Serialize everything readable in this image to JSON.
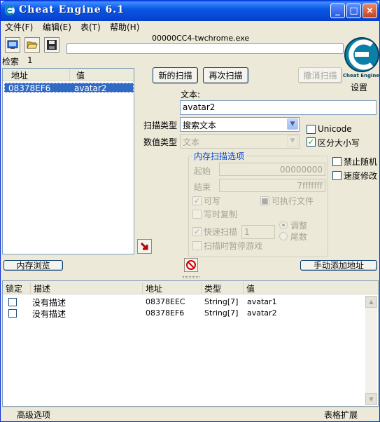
{
  "window": {
    "title": "Cheat Engine 6.1",
    "btn_minimize": "_",
    "btn_maximize": "□",
    "btn_close": "×"
  },
  "menu": [
    "文件(F)",
    "编辑(E)",
    "表(T)",
    "帮助(H)"
  ],
  "process": {
    "name": "00000CC4-twchrome.exe"
  },
  "found": {
    "label": "检索",
    "count": "1"
  },
  "results": {
    "col_address": "地址",
    "col_value": "值",
    "rows": [
      {
        "address": "08378EF6",
        "value": "avatar2"
      }
    ]
  },
  "scan": {
    "new_scan": "新的扫描",
    "next_scan": "再次扫描",
    "undo_scan": "撤消扫描",
    "settings": "设置",
    "text_label": "文本:",
    "text_value": "avatar2",
    "scan_type_label": "扫描类型",
    "scan_type_value": "搜索文本",
    "value_type_label": "数值类型",
    "value_type_value": "文本",
    "unicode_label": "Unicode",
    "case_label": "区分大小写",
    "case_check": "✓"
  },
  "memory_options": {
    "title": "内存扫描选项",
    "start_label": "起始",
    "start_value": "00000000",
    "stop_label": "结束",
    "stop_value": "7fffffff",
    "writable": "可写",
    "executable": "可执行文件",
    "copy_on_write": "写时复制",
    "fast_scan": "快速扫描",
    "fast_scan_value": "1",
    "align": "调整",
    "last_digits": "尾数",
    "pause_scan": "扫描时暂停游戏",
    "check_mark": "✓"
  },
  "side_options": {
    "disable_random": "禁止随机",
    "speedhack": "速度修改"
  },
  "buttons": {
    "memory_view": "内存浏览",
    "add_address": "手动添加地址"
  },
  "cheat_table": {
    "headers": [
      "锁定",
      "描述",
      "地址",
      "类型",
      "值"
    ],
    "rows": [
      {
        "description": "没有描述",
        "address": "08378EEC",
        "type": "String[7]",
        "value": "avatar1"
      },
      {
        "description": "没有描述",
        "address": "08378EF6",
        "type": "String[7]",
        "value": "avatar2"
      }
    ]
  },
  "footer": {
    "advanced": "高级选项",
    "table_extras": "表格扩展"
  },
  "colors": {
    "selection": "#316ac5",
    "titlebar": "#0a58e6",
    "logo": "#0a7fa8"
  },
  "icons": [
    "cheat-engine-icon",
    "process-select-icon",
    "open-icon",
    "save-icon",
    "arrow-down-icon",
    "stop-icon",
    "cheat-engine-logo"
  ]
}
